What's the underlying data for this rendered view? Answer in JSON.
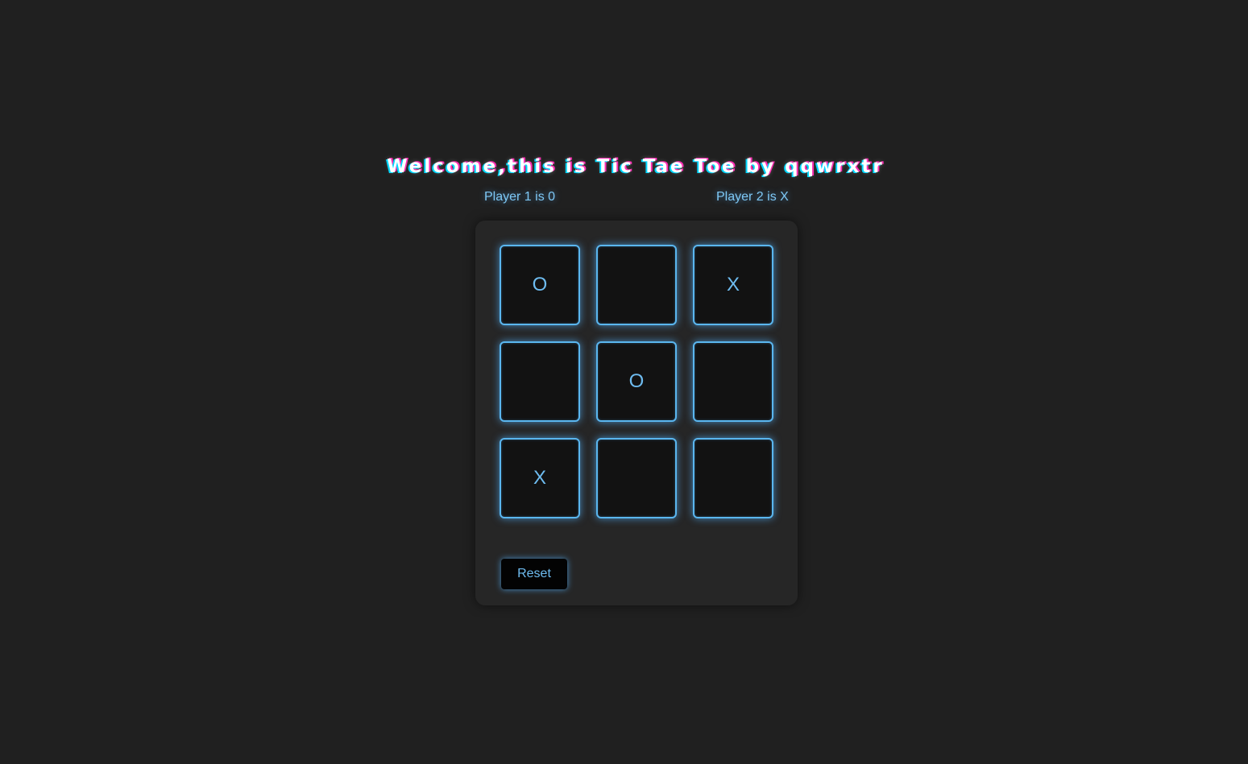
{
  "header": {
    "title": "Welcome,this is Tic Tae Toe by qqwrxtr",
    "player1_label": "Player 1 is 0",
    "player2_label": "Player 2 is X"
  },
  "board": {
    "cells": [
      "O",
      "",
      "X",
      "",
      "O",
      "",
      "X",
      "",
      ""
    ]
  },
  "controls": {
    "reset_label": "Reset"
  },
  "colors": {
    "background": "#202020",
    "panel": "#262626",
    "cell_background": "#121212",
    "accent": "#5ab6ef",
    "text_glow": "#6ebcf0"
  }
}
